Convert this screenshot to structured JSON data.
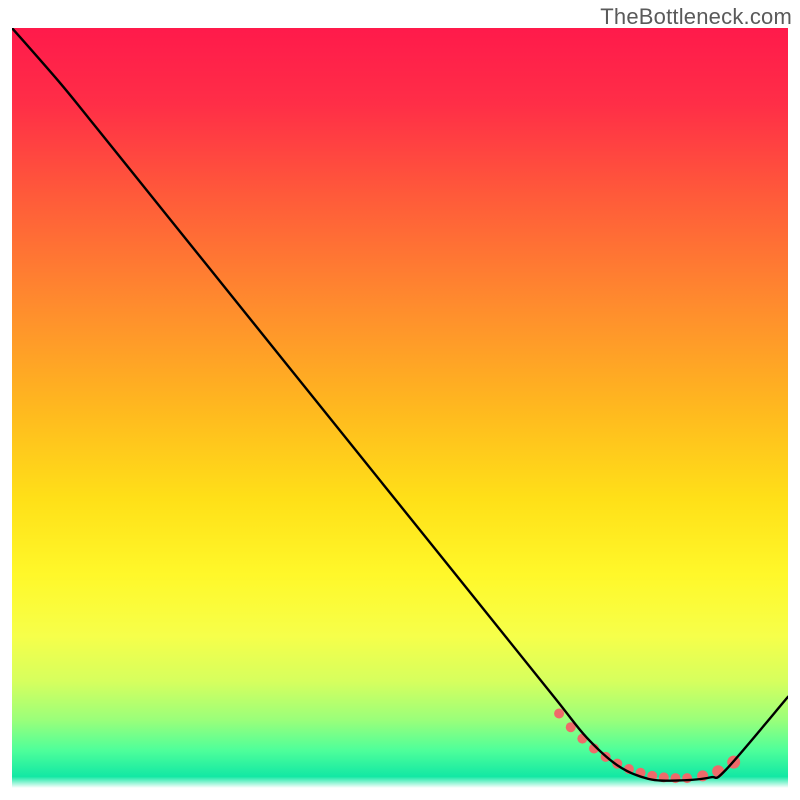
{
  "watermark": "TheBottleneck.com",
  "chart_data": {
    "type": "line",
    "title": "",
    "xlabel": "",
    "ylabel": "",
    "xlim": [
      0,
      100
    ],
    "ylim": [
      0,
      100
    ],
    "grid": false,
    "legend": false,
    "series": [
      {
        "name": "bottleneck-curve",
        "x": [
          0,
          6,
          10,
          20,
          30,
          40,
          50,
          60,
          70,
          74,
          78,
          82,
          86,
          90,
          92,
          100
        ],
        "y": [
          100,
          93,
          88,
          75.3,
          62.6,
          49.9,
          37.2,
          24.5,
          11.8,
          6.7,
          3.0,
          1.2,
          1.0,
          1.4,
          2.4,
          12.0
        ]
      }
    ],
    "markers": [
      {
        "name": "optimal-range-dots",
        "x": [
          70.5,
          72,
          73.5,
          75,
          76.5,
          78,
          79.5,
          81,
          82.5,
          84,
          85.5,
          87,
          89,
          91,
          93
        ],
        "y": [
          9.8,
          8.0,
          6.5,
          5.2,
          4.1,
          3.2,
          2.5,
          2.0,
          1.6,
          1.4,
          1.3,
          1.3,
          1.6,
          2.2,
          3.4
        ],
        "r": [
          5,
          5,
          5,
          5,
          5,
          5,
          5,
          5,
          5,
          5,
          5,
          5,
          5.5,
          6,
          6.5
        ]
      }
    ],
    "gradient_stops": [
      {
        "offset": 0.0,
        "color": "#ff1a4b"
      },
      {
        "offset": 0.1,
        "color": "#ff2e47"
      },
      {
        "offset": 0.22,
        "color": "#ff5a3a"
      },
      {
        "offset": 0.36,
        "color": "#ff8a2e"
      },
      {
        "offset": 0.5,
        "color": "#ffb81f"
      },
      {
        "offset": 0.62,
        "color": "#ffe018"
      },
      {
        "offset": 0.72,
        "color": "#fff82a"
      },
      {
        "offset": 0.8,
        "color": "#f6ff4a"
      },
      {
        "offset": 0.86,
        "color": "#d6ff5e"
      },
      {
        "offset": 0.91,
        "color": "#9bff7a"
      },
      {
        "offset": 0.95,
        "color": "#4fff9a"
      },
      {
        "offset": 0.985,
        "color": "#12e8a4"
      },
      {
        "offset": 1.0,
        "color": "#ffffff"
      }
    ],
    "marker_color": "#ef6a6a",
    "line_color": "#000000",
    "line_width": 2.4
  }
}
